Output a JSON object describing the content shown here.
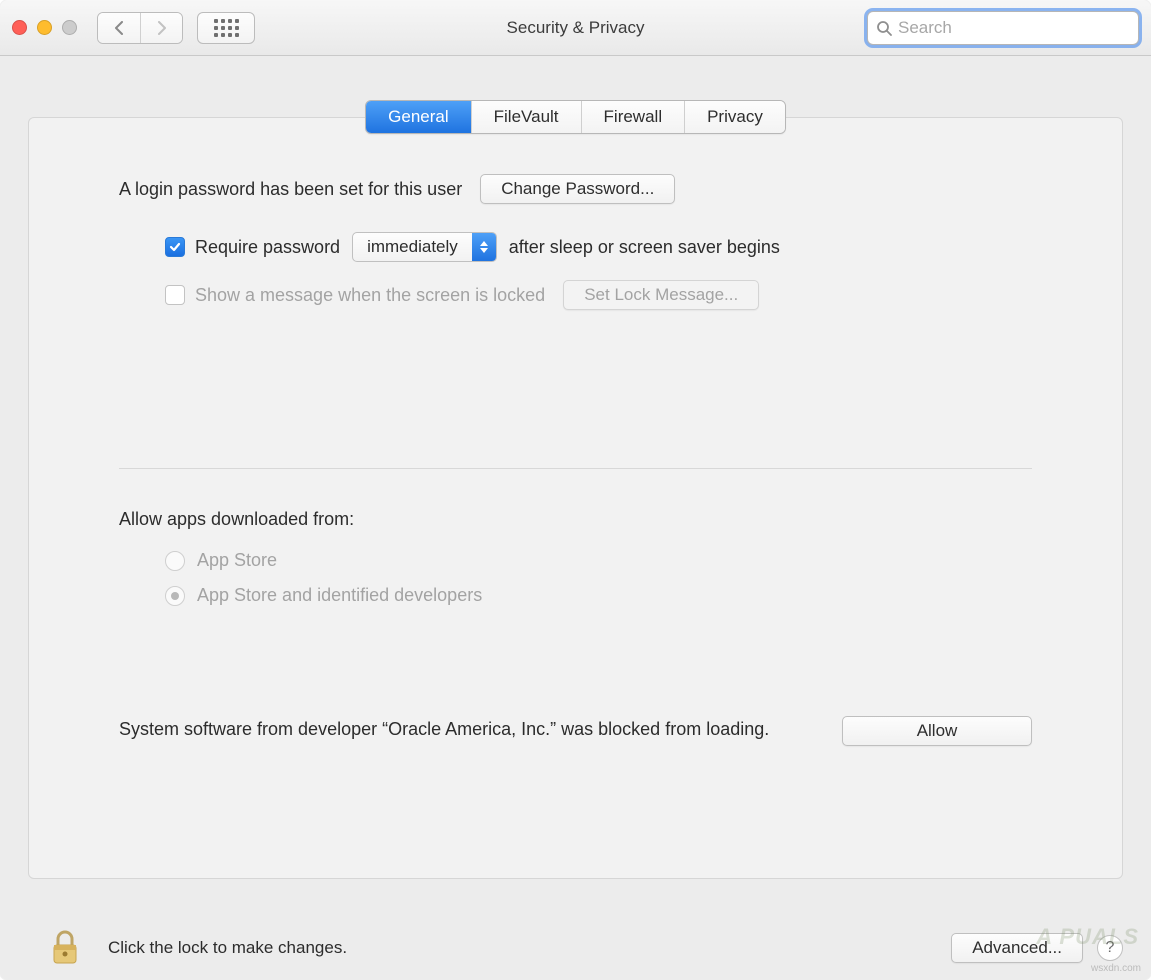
{
  "window": {
    "title": "Security & Privacy"
  },
  "search": {
    "placeholder": "Search",
    "value": ""
  },
  "tabs": {
    "general": "General",
    "filevault": "FileVault",
    "firewall": "Firewall",
    "privacy": "Privacy",
    "active": "General"
  },
  "login": {
    "status_text": "A login password has been set for this user",
    "change_button": "Change Password...",
    "require_password_label": "Require password",
    "require_password_checked": true,
    "delay_selected": "immediately",
    "after_text": "after sleep or screen saver begins",
    "show_message_label": "Show a message when the screen is locked",
    "show_message_checked": false,
    "set_lock_message_button": "Set Lock Message..."
  },
  "gatekeeper": {
    "section_label": "Allow apps downloaded from:",
    "option_appstore": "App Store",
    "option_identified": "App Store and identified developers",
    "selected": "identified",
    "locked": true
  },
  "blocked": {
    "message": "System software from developer “Oracle America, Inc.” was blocked from loading.",
    "allow_button": "Allow"
  },
  "footer": {
    "lock_text": "Click the lock to make changes.",
    "advanced_button": "Advanced...",
    "help_label": "?"
  },
  "watermark": "A  PUALS",
  "wsxdn": "wsxdn.com"
}
